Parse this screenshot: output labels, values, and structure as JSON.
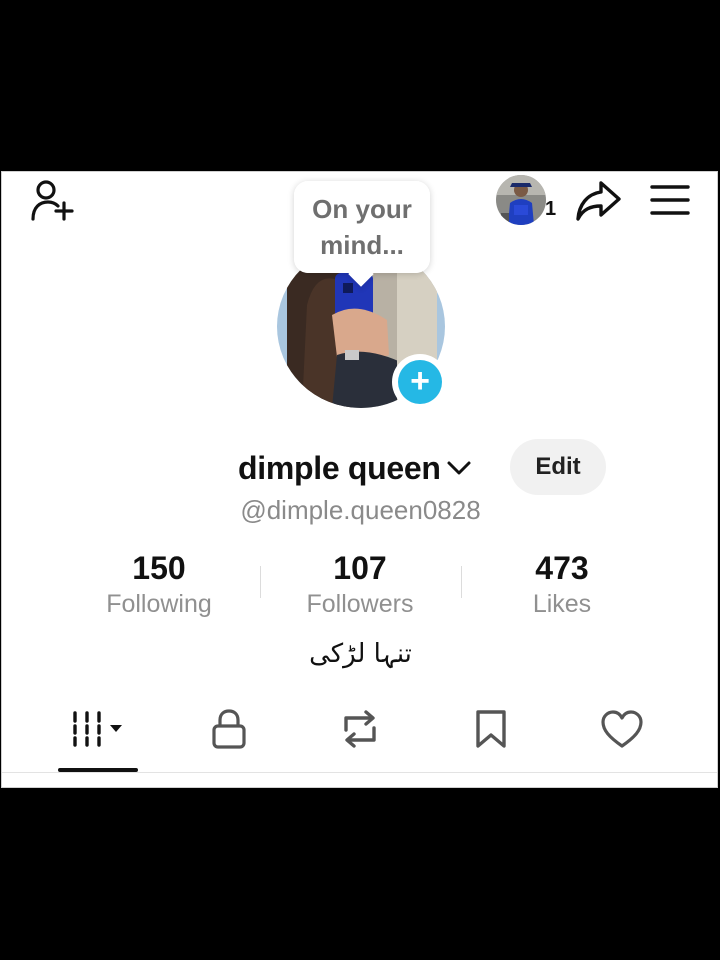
{
  "header": {
    "notification_count": "1",
    "icons": [
      "add-friend-icon",
      "share-icon",
      "menu-icon"
    ]
  },
  "profile": {
    "bubble_text": "On your mind...",
    "display_name": "dimple queen",
    "username": "@dimple.queen0828",
    "edit_label": "Edit",
    "bio": "تنہا لڑکی"
  },
  "stats": [
    {
      "value": "150",
      "label": "Following"
    },
    {
      "value": "107",
      "label": "Followers"
    },
    {
      "value": "473",
      "label": "Likes"
    }
  ],
  "tabs": [
    {
      "icon": "videos-grid-icon",
      "selected": true
    },
    {
      "icon": "lock-icon",
      "selected": false
    },
    {
      "icon": "repost-icon",
      "selected": false
    },
    {
      "icon": "bookmark-icon",
      "selected": false
    },
    {
      "icon": "heart-icon",
      "selected": false
    }
  ],
  "colors": {
    "accent": "#25b8e5",
    "text_primary": "#111111",
    "text_secondary": "#909090",
    "button_bg": "#f1f1f1"
  }
}
